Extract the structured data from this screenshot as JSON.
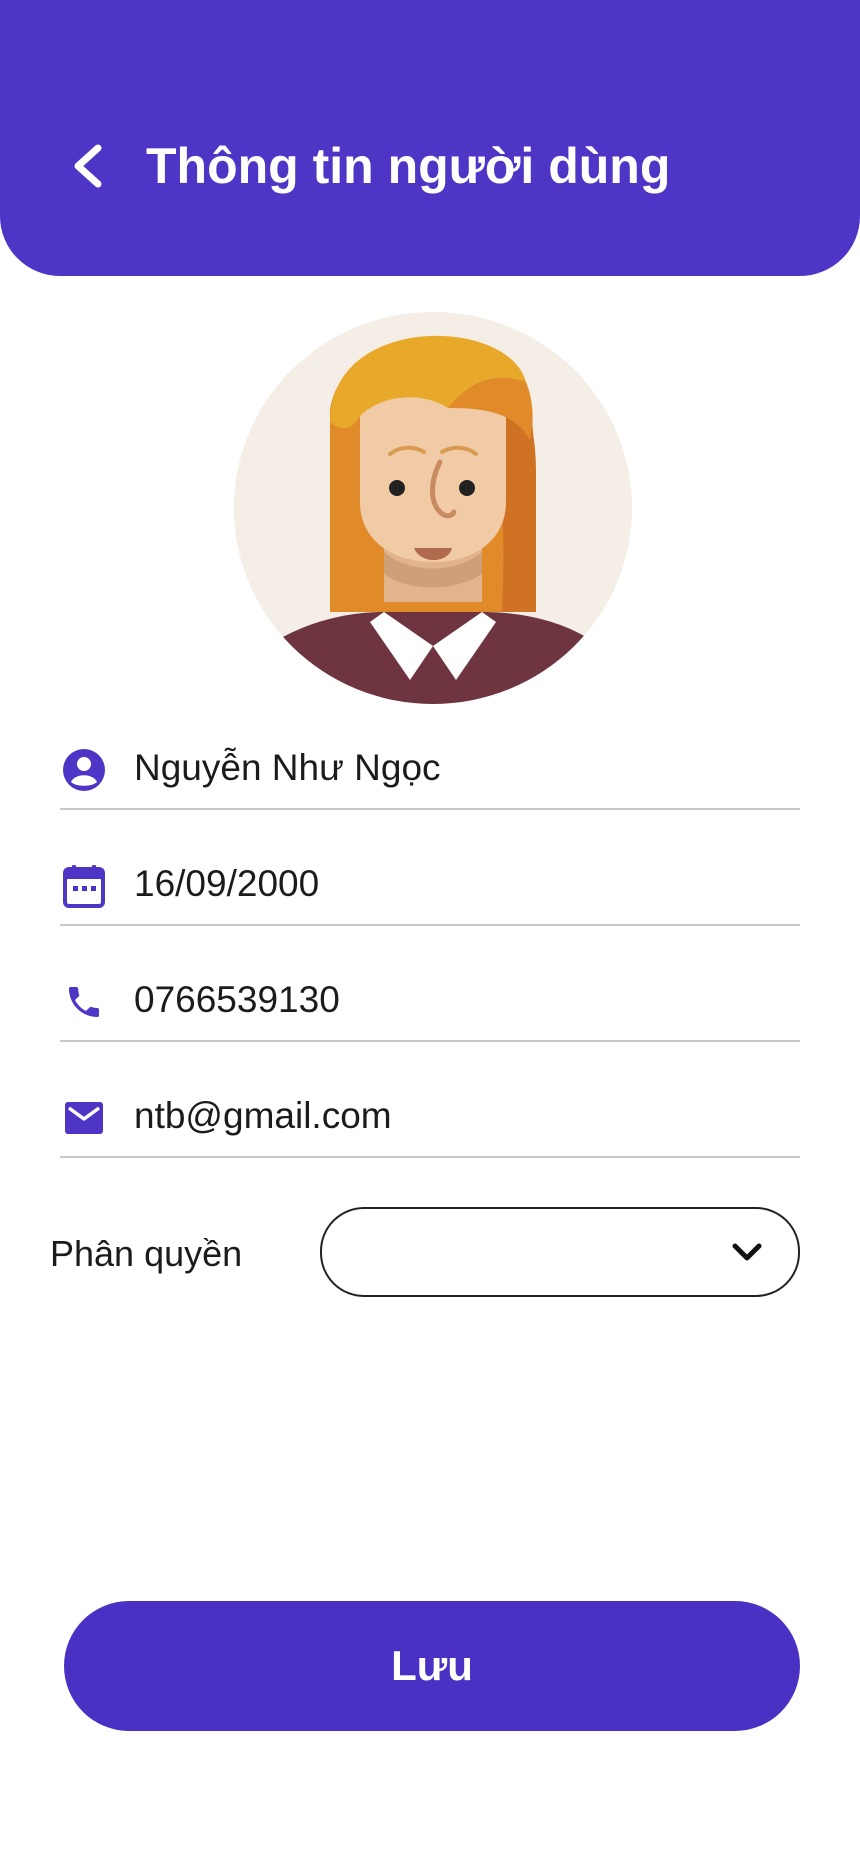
{
  "header": {
    "title": "Thông tin người dùng",
    "back_icon": "chevron-left-icon"
  },
  "profile": {
    "avatar": "female-avatar-illustration"
  },
  "fields": {
    "name": {
      "icon": "account-circle-icon",
      "value": "Nguyễn Như Ngọc"
    },
    "birthdate": {
      "icon": "calendar-icon",
      "value": "16/09/2000"
    },
    "phone": {
      "icon": "phone-icon",
      "value": "0766539130"
    },
    "email": {
      "icon": "mail-icon",
      "value": "ntb@gmail.com"
    }
  },
  "role": {
    "label": "Phân quyền",
    "selected": "",
    "dropdown_icon": "chevron-down-icon"
  },
  "actions": {
    "save_label": "Lưu"
  },
  "colors": {
    "primary": "#4f35c6",
    "button": "#4a31c4",
    "divider": "#c9c9c9",
    "text": "#1b1b1b"
  }
}
